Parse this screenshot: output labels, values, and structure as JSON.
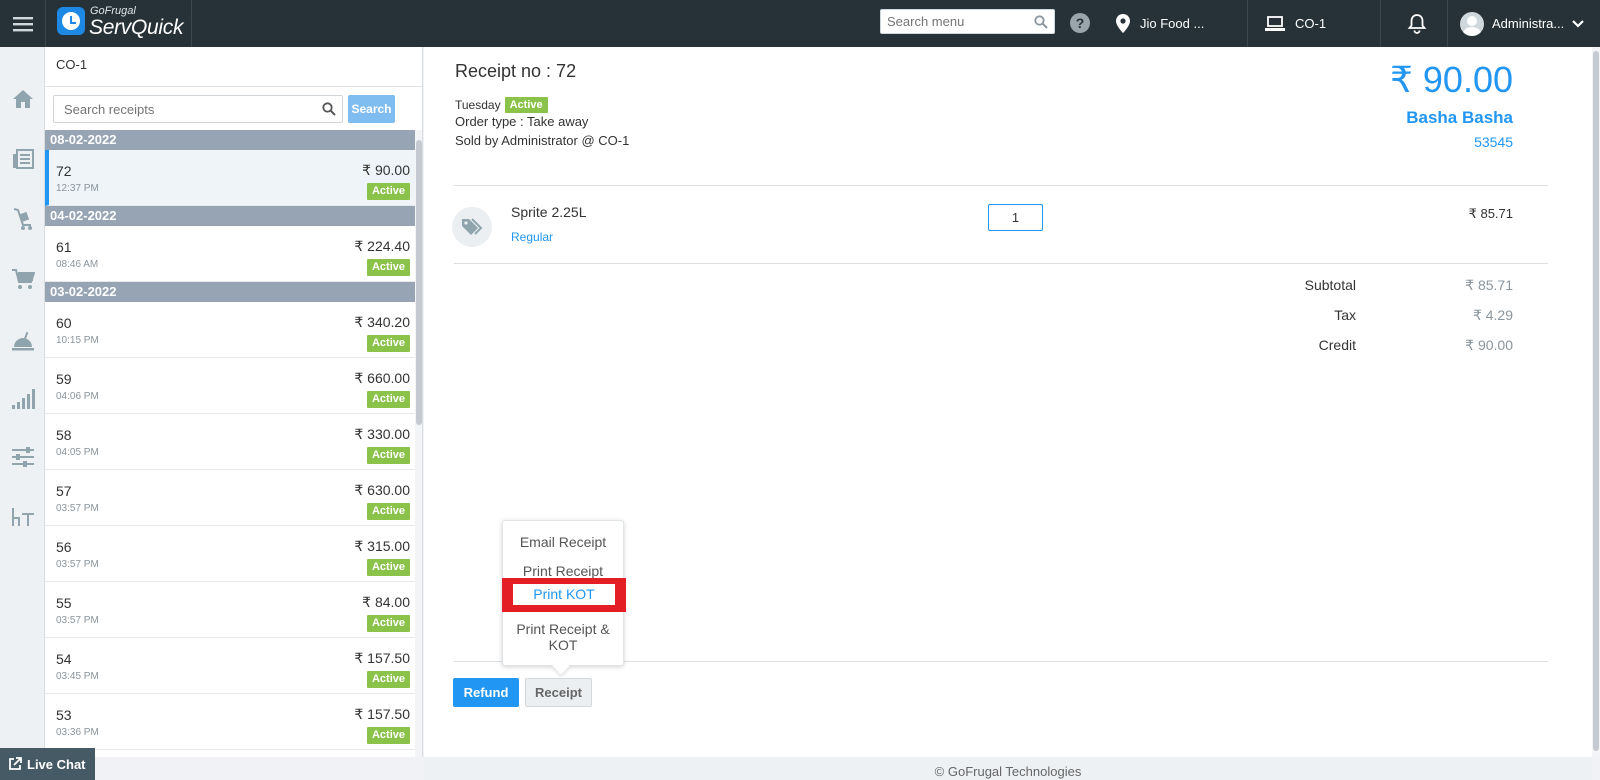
{
  "topbar": {
    "brand_sub": "GoFrugal",
    "brand_main": "ServQuick",
    "search_placeholder": "Search menu",
    "location": "Jio Food ...",
    "counter": "CO-1",
    "user": "Administra..."
  },
  "sidebar": {
    "icons": [
      "home-icon",
      "newspaper-icon",
      "cart-trolley-icon",
      "shopping-cart-icon",
      "food-cloche-icon",
      "signal-bars-icon",
      "sliders-icon",
      "table-icon"
    ]
  },
  "receipt_list": {
    "header": "CO-1",
    "search_placeholder": "Search receipts",
    "search_button": "Search",
    "groups": [
      {
        "date": "08-02-2022",
        "items": [
          {
            "number": "72",
            "time": "12:37 PM",
            "amount": "₹ 90.00",
            "status": "Active"
          }
        ]
      },
      {
        "date": "04-02-2022",
        "items": [
          {
            "number": "61",
            "time": "08:46 AM",
            "amount": "₹ 224.40",
            "status": "Active"
          }
        ]
      },
      {
        "date": "03-02-2022",
        "items": [
          {
            "number": "60",
            "time": "10:15 PM",
            "amount": "₹ 340.20",
            "status": "Active"
          },
          {
            "number": "59",
            "time": "04:06 PM",
            "amount": "₹ 660.00",
            "status": "Active"
          },
          {
            "number": "58",
            "time": "04:05 PM",
            "amount": "₹ 330.00",
            "status": "Active"
          },
          {
            "number": "57",
            "time": "03:57 PM",
            "amount": "₹ 630.00",
            "status": "Active"
          },
          {
            "number": "56",
            "time": "03:57 PM",
            "amount": "₹ 315.00",
            "status": "Active"
          },
          {
            "number": "55",
            "time": "03:57 PM",
            "amount": "₹ 84.00",
            "status": "Active"
          },
          {
            "number": "54",
            "time": "03:45 PM",
            "amount": "₹ 157.50",
            "status": "Active"
          },
          {
            "number": "53",
            "time": "03:36 PM",
            "amount": "₹ 157.50",
            "status": "Active"
          }
        ]
      }
    ]
  },
  "receipt": {
    "title": "Receipt no : 72",
    "day": "Tuesday",
    "status": "Active",
    "order_type": "Order type : Take away",
    "sold_by": "Sold by Administrator @ CO-1",
    "total": "₹ 90.00",
    "customer_name": "Basha Basha",
    "customer_number": "53545",
    "item": {
      "name": "Sprite 2.25L",
      "variant": "Regular",
      "qty": "1",
      "price": "₹ 85.71"
    },
    "totals": [
      {
        "label": "Subtotal",
        "value": "₹ 85.71"
      },
      {
        "label": "Tax",
        "value": "₹ 4.29"
      },
      {
        "label": "Credit",
        "value": "₹ 90.00"
      }
    ],
    "refund_label": "Refund",
    "receipt_label": "Receipt"
  },
  "menu": {
    "email_receipt": "Email Receipt",
    "print_receipt": "Print Receipt",
    "print_kot": "Print KOT",
    "print_receipt_kot_line1": "Print Receipt &",
    "print_receipt_kot_line2": "KOT"
  },
  "footer": "© GoFrugal Technologies",
  "live_chat": "Live Chat",
  "colors": {
    "topbar": "#263238",
    "accent": "#2196f3",
    "active_badge": "#8bc34a",
    "date_header": "#96a4b4",
    "highlight": "#e31e24"
  }
}
